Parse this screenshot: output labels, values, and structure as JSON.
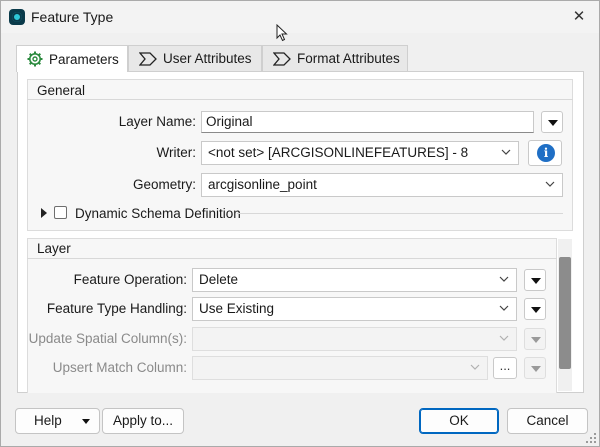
{
  "window": {
    "title": "Feature Type"
  },
  "icons": {
    "app": "fme-app-icon",
    "close": "close-icon",
    "params_tab": "gear-icon",
    "attr_tab": "attribute-tag-icon",
    "info": "info-icon",
    "dropdown": "chevron-down-icon",
    "menu": "triangle-down-icon"
  },
  "close_glyph": "✕",
  "tabs": [
    {
      "label": "Parameters",
      "active": true
    },
    {
      "label": "User Attributes",
      "active": false
    },
    {
      "label": "Format Attributes",
      "active": false
    }
  ],
  "general": {
    "title": "General",
    "layer_name_label": "Layer Name:",
    "layer_name_value": "Original",
    "writer_label": "Writer:",
    "writer_value": "<not set> [ARCGISONLINEFEATURES] - 8",
    "geometry_label": "Geometry:",
    "geometry_value": "arcgisonline_point",
    "dynamic_schema_label": "Dynamic Schema Definition",
    "dynamic_schema_checked": false
  },
  "layer": {
    "title": "Layer",
    "feature_operation_label": "Feature Operation:",
    "feature_operation_value": "Delete",
    "feature_type_handling_label": "Feature Type Handling:",
    "feature_type_handling_value": "Use Existing",
    "update_spatial_label": "Update Spatial Column(s):",
    "update_spatial_value": "",
    "upsert_match_label": "Upsert Match Column:",
    "upsert_match_value": "",
    "dots_label": "..."
  },
  "footer": {
    "help_label": "Help",
    "apply_label": "Apply to...",
    "ok_label": "OK",
    "cancel_label": "Cancel"
  },
  "colors": {
    "accent": "#0067c0",
    "info_blue": "#1f6fc5",
    "app_icon_teal": "#2ec7d8"
  }
}
